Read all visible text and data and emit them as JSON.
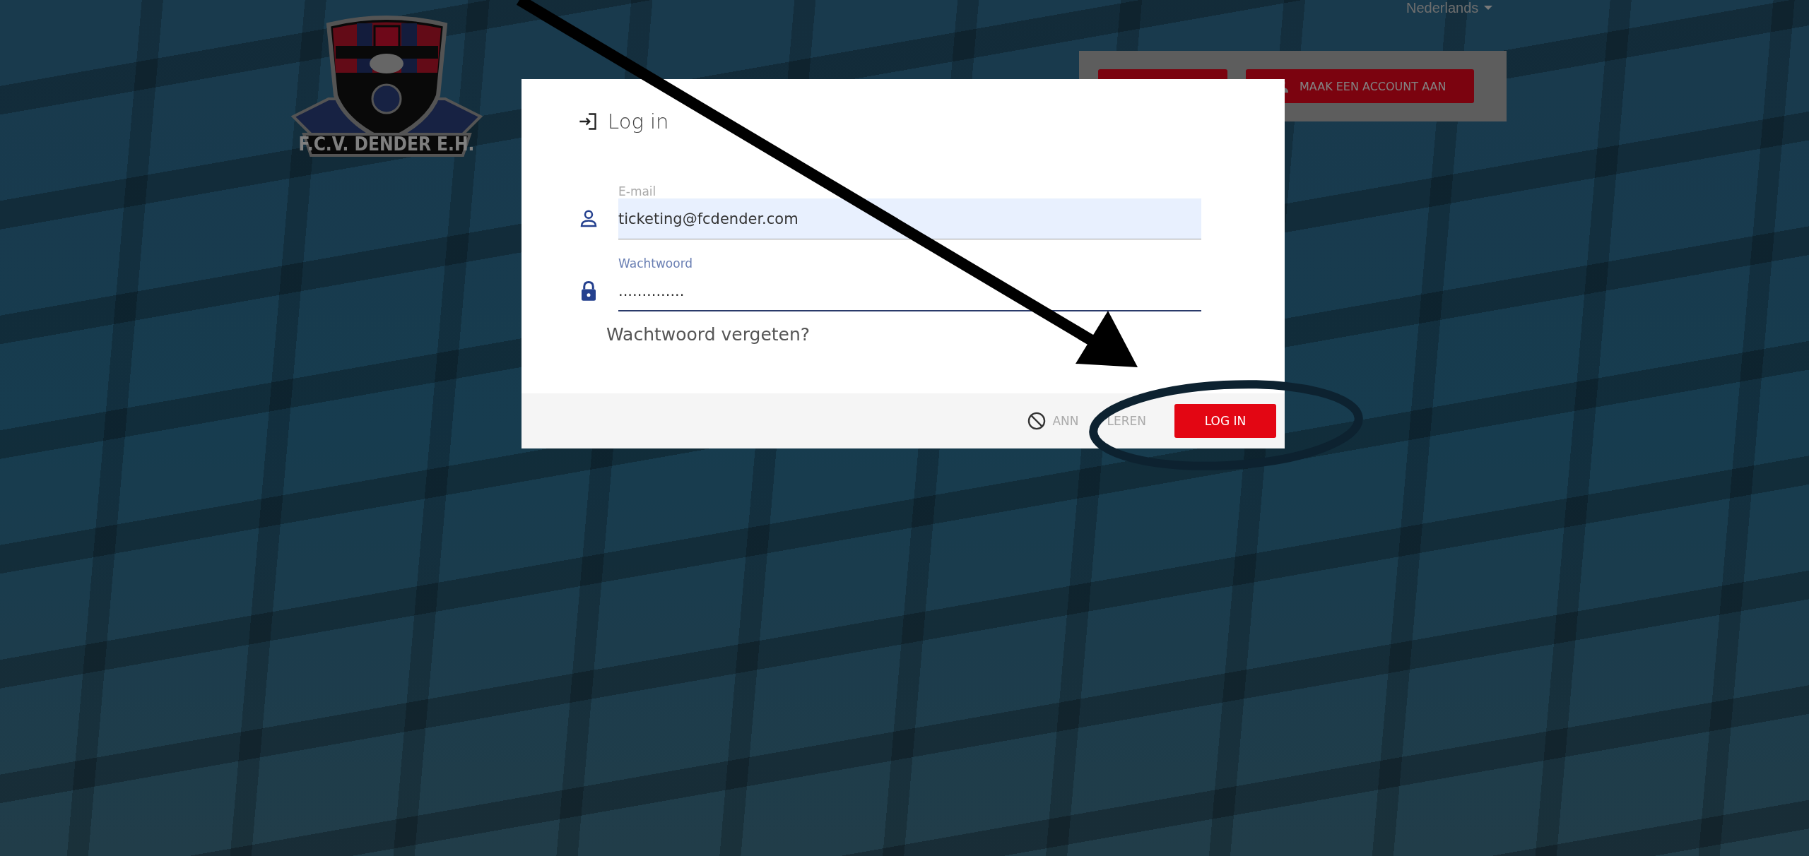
{
  "header": {
    "language": "Nederlands",
    "account_buttons": [
      {
        "kind": "blank"
      },
      {
        "kind": "register",
        "label": "MAAK EEN ACCOUNT AAN"
      }
    ]
  },
  "logo": {
    "text": "F.C.V. DENDER E.H."
  },
  "dialog": {
    "title": "Log in",
    "fields": [
      {
        "kind": "email",
        "label": "E-mail",
        "value": "ticketing@fcdender.com",
        "autofilled": true,
        "focused": false
      },
      {
        "kind": "password",
        "label": "Wachtwoord",
        "value": "..............",
        "autofilled": false,
        "focused": true
      }
    ],
    "forgot_link": "Wachtwoord vergeten?",
    "buttons": [
      {
        "kind": "cancel",
        "label": "ANN",
        "label_after": "LEREN"
      },
      {
        "kind": "primary",
        "label": "LOG IN"
      }
    ]
  }
}
